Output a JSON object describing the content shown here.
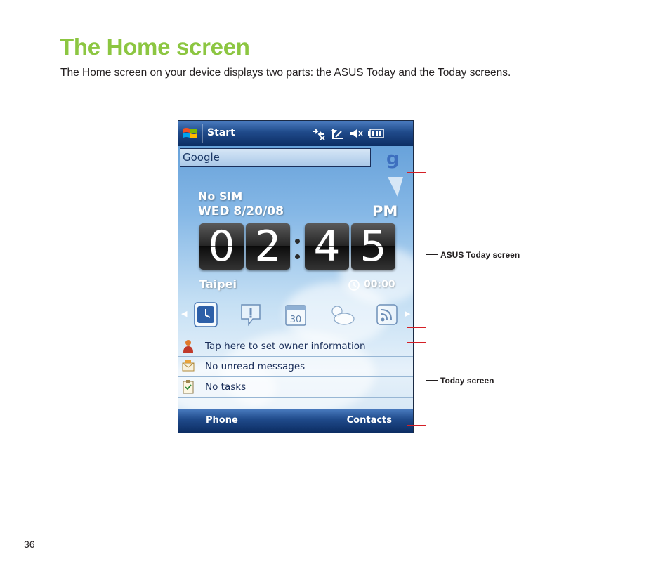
{
  "page": {
    "title": "The Home screen",
    "intro": "The Home screen on your device displays two parts: the ASUS Today and the Today screens.",
    "page_number": "36"
  },
  "device": {
    "titlebar": {
      "start_label": "Start"
    },
    "search": {
      "value": "Google",
      "brand_glyph": "g"
    },
    "asus_today": {
      "sim_status": "No SIM",
      "date": "WED 8/20/08",
      "ampm": "PM",
      "clock_digits": [
        "0",
        "2",
        "4",
        "5"
      ],
      "city": "Taipei",
      "alarm_time": "00:00",
      "tabs": [
        "clock-icon",
        "notification-icon",
        "calendar-icon",
        "weather-icon",
        "rss-icon"
      ],
      "calendar_glyph": "30"
    },
    "today_items": [
      {
        "label": "Tap here to set owner information",
        "icon": "owner-icon"
      },
      {
        "label": "No unread messages",
        "icon": "messages-icon"
      },
      {
        "label": "No tasks",
        "icon": "tasks-icon"
      }
    ],
    "softkeys": {
      "left": "Phone",
      "right": "Contacts"
    }
  },
  "callouts": {
    "asus_today": "ASUS Today screen",
    "today": "Today screen"
  },
  "colors": {
    "title_green": "#8cc641",
    "bracket_red": "#d42027",
    "bar_blue": "#1f4a8a"
  }
}
